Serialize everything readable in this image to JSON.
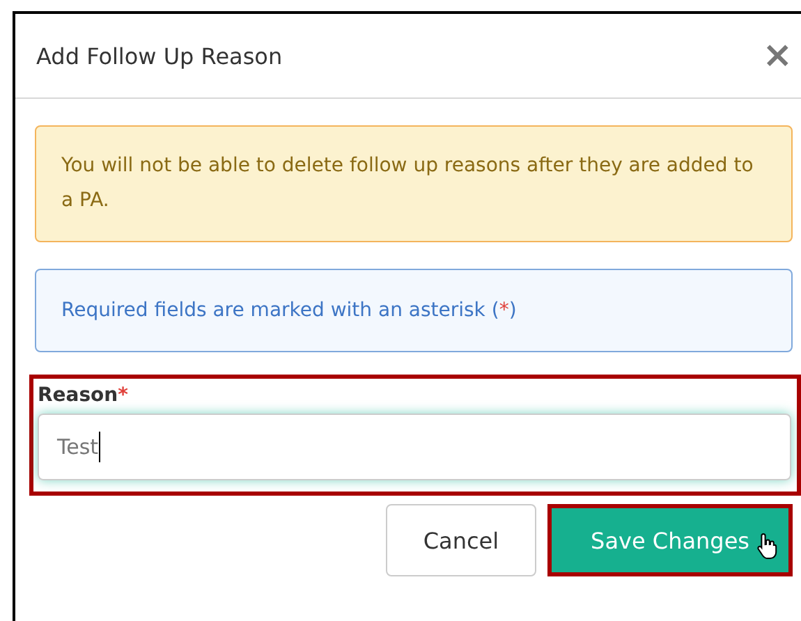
{
  "dialog": {
    "title": "Add Follow Up Reason",
    "close": "×"
  },
  "warning": "You will not be able to delete follow up reasons after they are added to a PA.",
  "info": {
    "text": "Required fields are marked with an asterisk (",
    "mark": "*",
    "end": ")"
  },
  "field": {
    "label": "Reason",
    "required_mark": "*",
    "value": "Test",
    "focused": true,
    "highlighted": true
  },
  "buttons": [
    {
      "label": "Cancel",
      "kind": "secondary",
      "highlighted": false,
      "hovered": false
    },
    {
      "label": "Save Changes",
      "kind": "primary",
      "highlighted": true,
      "hovered": true
    }
  ]
}
